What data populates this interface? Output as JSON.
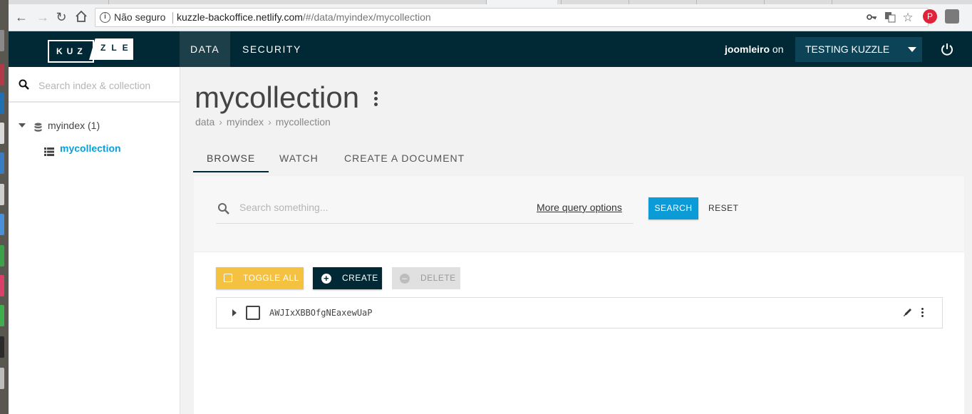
{
  "browser": {
    "security_label": "Não seguro",
    "url_host": "kuzzle-backoffice.netlify.com",
    "url_path": "/#/data/myindex/mycollection"
  },
  "header": {
    "logo_left": "KUZ",
    "logo_right": "ZLE",
    "nav": [
      {
        "label": "DATA",
        "active": true
      },
      {
        "label": "SECURITY",
        "active": false
      }
    ],
    "user_name": "joomleiro",
    "user_suffix": "on",
    "environment": "TESTING KUZZLE"
  },
  "sidebar": {
    "search_placeholder": "Search index & collection",
    "index_label": "myindex (1)",
    "collection_label": "mycollection"
  },
  "main": {
    "title": "mycollection",
    "breadcrumb": [
      "data",
      "myindex",
      "mycollection"
    ],
    "breadcrumb_separator": "›",
    "tabs": [
      "BROWSE",
      "WATCH",
      "CREATE A DOCUMENT"
    ],
    "active_tab": "BROWSE",
    "search_placeholder": "Search something...",
    "more_query_options": "More query options",
    "search_button": "SEARCH",
    "reset_button": "RESET",
    "toggle_all_button": "TOGGLE ALL",
    "create_button": "CREATE",
    "delete_button": "DELETE",
    "documents": [
      {
        "id": "AWJIxXBBOfgNEaxewUaP"
      }
    ]
  },
  "colors": {
    "header_bg": "#002835",
    "accent_blue": "#0b9bd6",
    "toggle_yellow": "#f5c141",
    "collection_link": "#0aa0d8"
  }
}
